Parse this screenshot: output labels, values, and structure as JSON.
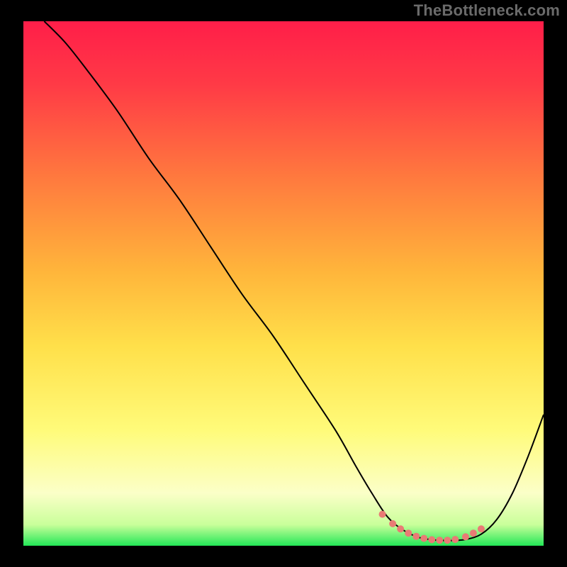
{
  "header": {
    "attribution": "TheBottleneck.com"
  },
  "colors": {
    "page_bg": "#000000",
    "curve": "#000000",
    "marker": "#e97b75",
    "gradient_stops": [
      {
        "offset": "0%",
        "color": "#ff1e49"
      },
      {
        "offset": "12%",
        "color": "#ff3a46"
      },
      {
        "offset": "30%",
        "color": "#ff7a3e"
      },
      {
        "offset": "48%",
        "color": "#ffb63b"
      },
      {
        "offset": "62%",
        "color": "#ffe04a"
      },
      {
        "offset": "78%",
        "color": "#fffb7a"
      },
      {
        "offset": "90%",
        "color": "#fbffc8"
      },
      {
        "offset": "96%",
        "color": "#c9ff9a"
      },
      {
        "offset": "100%",
        "color": "#23e757"
      }
    ]
  },
  "chart_data": {
    "type": "line",
    "title": "",
    "xlabel": "",
    "ylabel": "",
    "xlim": [
      0,
      100
    ],
    "ylim": [
      0,
      100
    ],
    "grid": false,
    "series": [
      {
        "name": "bottleneck-curve",
        "x": [
          4,
          8,
          12,
          18,
          24,
          30,
          36,
          42,
          48,
          54,
          60,
          64,
          67,
          70,
          73,
          76,
          79,
          82,
          85,
          88,
          91,
          94,
          97,
          100
        ],
        "y": [
          100,
          96,
          91,
          83,
          74,
          66,
          57,
          48,
          40,
          31,
          22,
          15,
          10,
          5.5,
          3,
          1.6,
          1.1,
          1.0,
          1.2,
          2.2,
          5,
          10,
          17,
          25
        ]
      }
    ],
    "markers": {
      "name": "optimal-region-dots",
      "x": [
        69,
        71,
        72.5,
        74,
        75.5,
        77,
        78.5,
        80,
        81.5,
        83,
        85,
        86.5,
        88
      ],
      "y": [
        6.0,
        4.2,
        3.2,
        2.4,
        1.8,
        1.4,
        1.15,
        1.05,
        1.05,
        1.2,
        1.7,
        2.4,
        3.2
      ],
      "radius_px": 5
    }
  }
}
